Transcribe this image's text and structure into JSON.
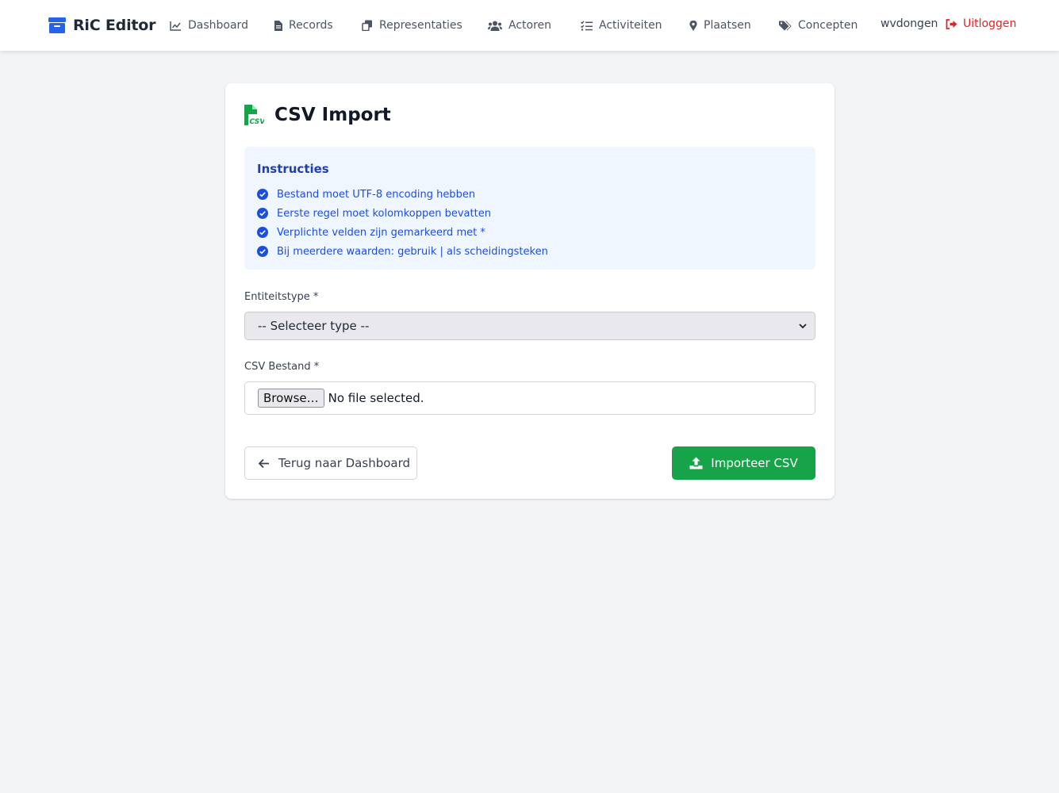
{
  "brand": {
    "title": "RiC Editor",
    "color": "#2563eb"
  },
  "nav": {
    "items": [
      {
        "label": "Dashboard",
        "icon": "chart-line-icon"
      },
      {
        "label": "Records",
        "icon": "file-icon"
      },
      {
        "label": "Representaties",
        "icon": "copy-icon"
      },
      {
        "label": "Actoren",
        "icon": "users-icon"
      },
      {
        "label": "Activiteiten",
        "icon": "list-check-icon"
      },
      {
        "label": "Plaatsen",
        "icon": "map-pin-icon"
      },
      {
        "label": "Concepten",
        "icon": "tags-icon"
      }
    ],
    "user": "wvdongen",
    "logout": "Uitloggen"
  },
  "page": {
    "title": "CSV Import",
    "instructions": {
      "heading": "Instructies",
      "items": [
        "Bestand moet UTF-8 encoding hebben",
        "Eerste regel moet kolomkoppen bevatten",
        "Verplichte velden zijn gemarkeerd met *",
        "Bij meerdere waarden: gebruik | als scheidingsteken"
      ]
    },
    "entity_type": {
      "label": "Entiteitstype *",
      "selected": "-- Selecteer type --"
    },
    "csv_file": {
      "label": "CSV Bestand *",
      "browse": "Browse…",
      "status": "No file selected."
    },
    "back_button": "Terug naar Dashboard",
    "import_button": "Importeer CSV"
  },
  "colors": {
    "accent": "#2563eb",
    "success": "#16a34a",
    "danger": "#dc2626",
    "info_bg": "#eff6ff"
  }
}
